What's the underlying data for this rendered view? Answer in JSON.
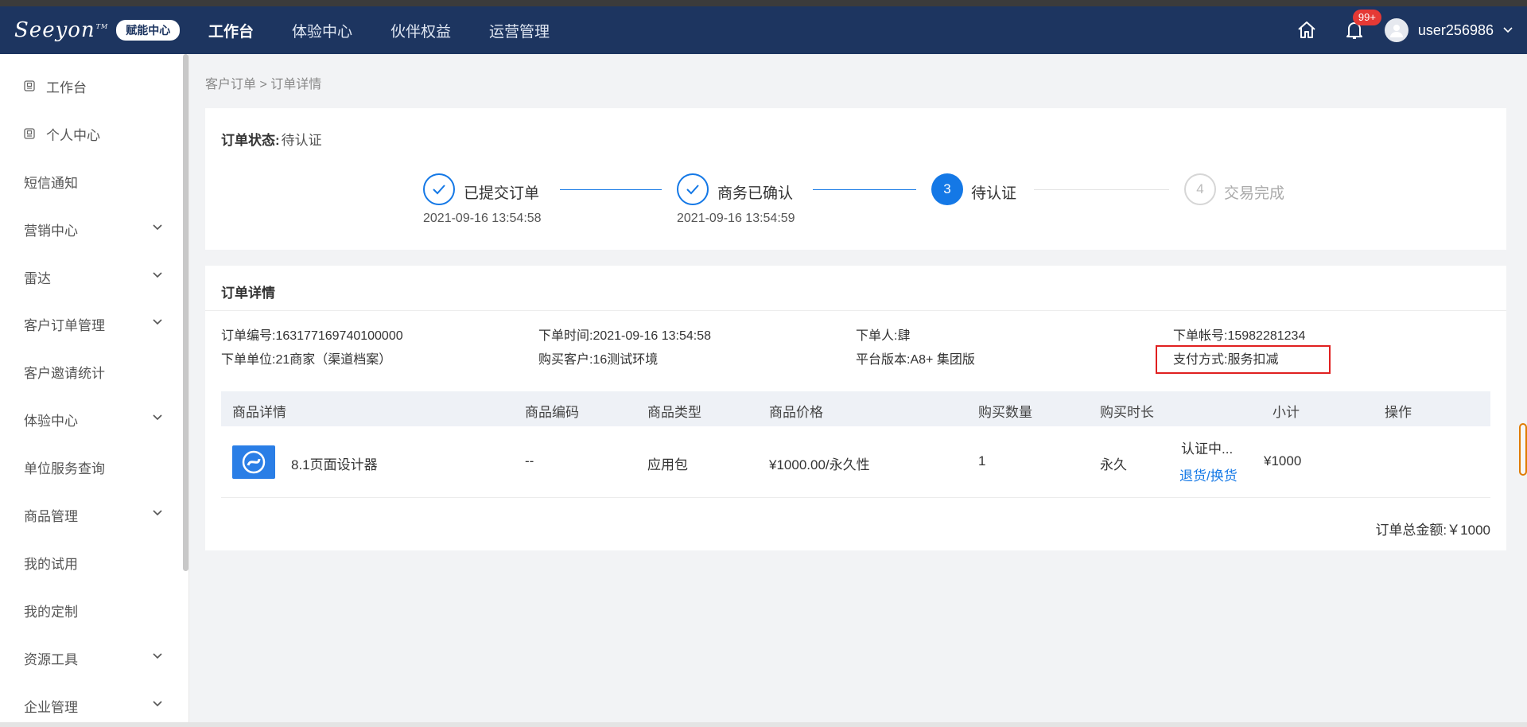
{
  "header": {
    "logo_text": "Seeyon",
    "logo_tm": "TM",
    "logo_badge": "赋能中心",
    "nav": [
      {
        "label": "工作台",
        "active": true
      },
      {
        "label": "体验中心",
        "active": false
      },
      {
        "label": "伙伴权益",
        "active": false
      },
      {
        "label": "运营管理",
        "active": false
      }
    ],
    "notification_count": "99+",
    "username": "user256986"
  },
  "sidebar": {
    "items": [
      {
        "label": "工作台",
        "icon": "document-icon",
        "expandable": false
      },
      {
        "label": "个人中心",
        "icon": "document-icon",
        "expandable": false
      },
      {
        "label": "短信通知",
        "expandable": false
      },
      {
        "label": "营销中心",
        "expandable": true
      },
      {
        "label": "雷达",
        "expandable": true
      },
      {
        "label": "客户订单管理",
        "expandable": true
      },
      {
        "label": "客户邀请统计",
        "expandable": false
      },
      {
        "label": "体验中心",
        "expandable": true
      },
      {
        "label": "单位服务查询",
        "expandable": false
      },
      {
        "label": "商品管理",
        "expandable": true
      },
      {
        "label": "我的试用",
        "expandable": false
      },
      {
        "label": "我的定制",
        "expandable": false
      },
      {
        "label": "资源工具",
        "expandable": true
      },
      {
        "label": "企业管理",
        "expandable": true
      }
    ]
  },
  "breadcrumb": "客户订单 > 订单详情",
  "order_status": {
    "label": "订单状态:",
    "value": "待认证"
  },
  "steps": [
    {
      "title": "已提交订单",
      "time": "2021-09-16 13:54:58",
      "state": "done"
    },
    {
      "title": "商务已确认",
      "time": "2021-09-16 13:54:59",
      "state": "done"
    },
    {
      "number": "3",
      "title": "待认证",
      "time": "",
      "state": "active"
    },
    {
      "number": "4",
      "title": "交易完成",
      "time": "",
      "state": "todo"
    }
  ],
  "order_detail": {
    "title": "订单详情",
    "fields": {
      "order_no": {
        "label": "订单编号:",
        "value": "163177169740100000"
      },
      "order_time": {
        "label": "下单时间:",
        "value": "2021-09-16 13:54:58"
      },
      "orderer": {
        "label": "下单人:",
        "value": "肆"
      },
      "account": {
        "label": "下单帐号:",
        "value": "15982281234"
      },
      "unit": {
        "label": "下单单位:",
        "value": "21商家（渠道档案）"
      },
      "customer": {
        "label": "购买客户:",
        "value": "16测试环境"
      },
      "platform": {
        "label": "平台版本:",
        "value": "A8+ 集团版"
      },
      "payment": {
        "label": "支付方式:",
        "value": "服务扣减"
      }
    }
  },
  "table": {
    "headers": [
      "商品详情",
      "商品编码",
      "商品类型",
      "商品价格",
      "购买数量",
      "购买时长",
      "小计",
      "操作"
    ],
    "rows": [
      {
        "name": "8.1页面设计器",
        "code": "--",
        "type": "应用包",
        "price": "¥1000.00/永久性",
        "quantity": "1",
        "duration": "永久",
        "subtotal": "¥1000",
        "status": "认证中...",
        "action": "退货/换货"
      }
    ]
  },
  "total": {
    "label": "订单总金额:",
    "value": "￥1000"
  },
  "colors": {
    "header_bg": "#1d3560",
    "accent": "#1478e6",
    "highlight": "#e02020",
    "badge": "#e53935"
  }
}
